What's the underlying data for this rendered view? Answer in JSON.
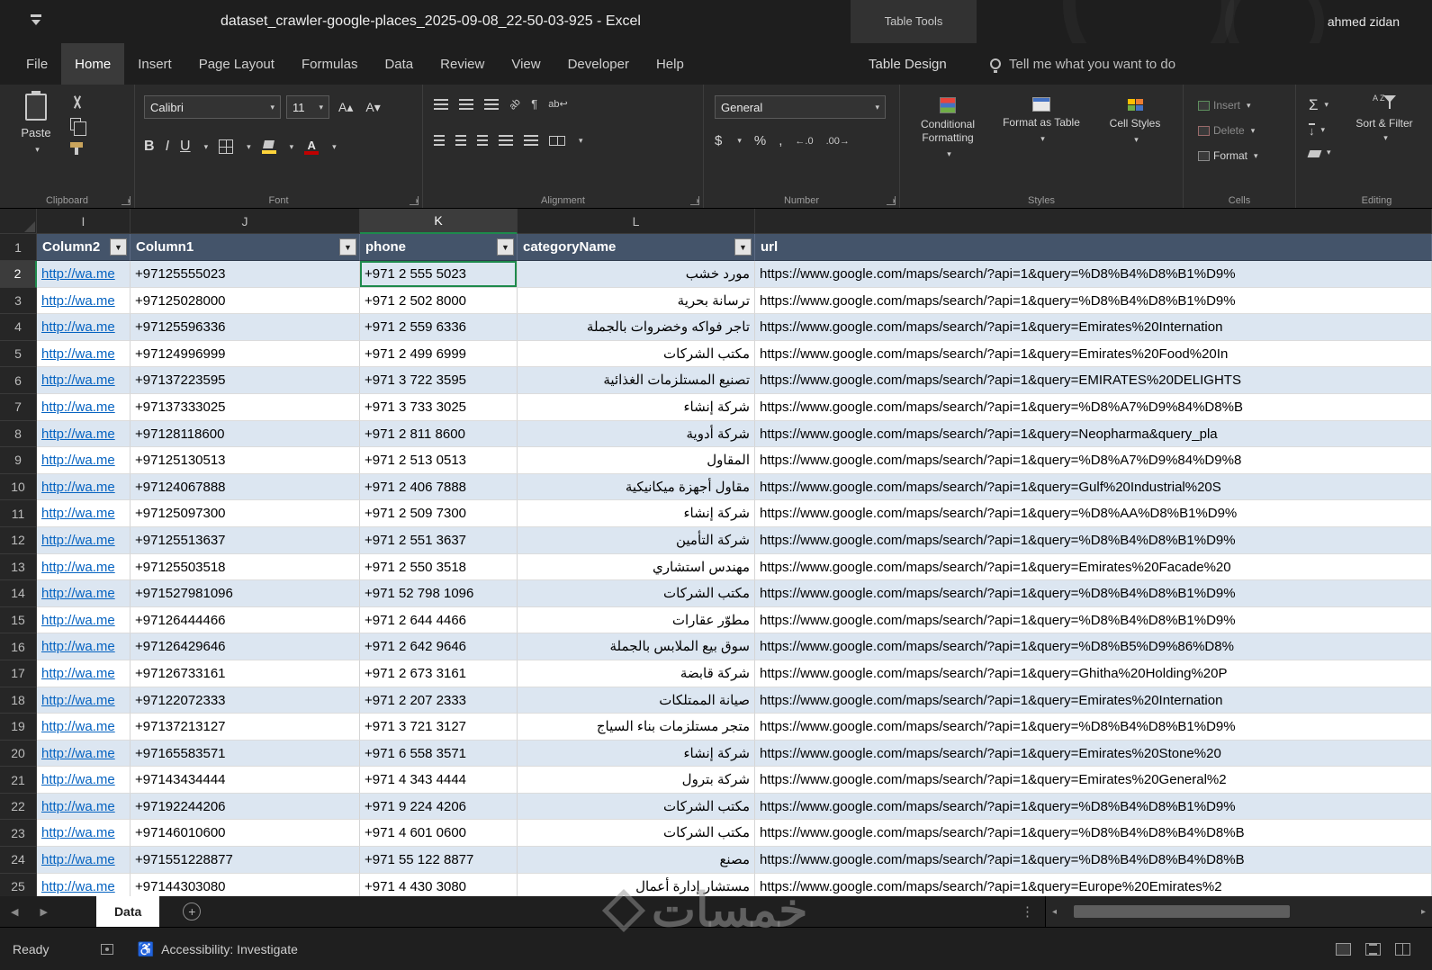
{
  "title_bar": {
    "title": "dataset_crawler-google-places_2025-09-08_22-50-03-925  -  Excel",
    "table_tools": "Table Tools",
    "user": "ahmed zidan"
  },
  "tabs": {
    "items": [
      "File",
      "Home",
      "Insert",
      "Page Layout",
      "Formulas",
      "Data",
      "Review",
      "View",
      "Developer",
      "Help"
    ],
    "contextual": "Table Design",
    "active": "Home",
    "tell_me": "Tell me what you want to do"
  },
  "ribbon": {
    "clipboard": {
      "paste": "Paste",
      "label": "Clipboard"
    },
    "font": {
      "name": "Calibri",
      "size": "11",
      "label": "Font"
    },
    "alignment": {
      "label": "Alignment"
    },
    "number": {
      "format": "General",
      "label": "Number"
    },
    "styles": {
      "conditional_formatting": "Conditional Formatting",
      "format_as_table": "Format as Table",
      "cell_styles": "Cell Styles",
      "label": "Styles"
    },
    "cells": {
      "insert": "Insert",
      "delete": "Delete",
      "format": "Format",
      "label": "Cells"
    },
    "editing": {
      "sort_filter": "Sort & Filter",
      "label": "Editing"
    }
  },
  "icons": {
    "dropdown": "▾",
    "filter": "▼",
    "bold": "B",
    "italic": "I",
    "underline": "U",
    "grow_font": "A▴",
    "shrink_font": "A▾",
    "font_color_letter": "A",
    "orientation": "ab",
    "wrap_text": "ab↩",
    "paragraph": "¶",
    "dollar": "$",
    "percent": "%",
    "comma": ",",
    "increase_decimal": "←.0",
    "decrease_decimal": ".00→",
    "sigma": "Σ",
    "fill_down": "↓",
    "sort_az": "A Z",
    "plus": "+",
    "kebab": "⋮",
    "tab_left": "◀",
    "tab_right": "▶",
    "scroll_left": "◂",
    "scroll_right": "▸",
    "accessibility": "♿"
  },
  "grid": {
    "column_letters": [
      "I",
      "J",
      "K",
      "L"
    ],
    "headers": [
      "Column2",
      "Column1",
      "phone",
      "categoryName",
      "url"
    ],
    "rows": [
      {
        "n": "2",
        "whatsapp": "http://wa.me",
        "column1": "+97125555023",
        "phone": "+971 2 555 5023",
        "category": "مورد خشب",
        "url": "https://www.google.com/maps/search/?api=1&query=%D8%B4%D8%B1%D9%"
      },
      {
        "n": "3",
        "whatsapp": "http://wa.me",
        "column1": "+97125028000",
        "phone": "+971 2 502 8000",
        "category": "ترسانة بحرية",
        "url": "https://www.google.com/maps/search/?api=1&query=%D8%B4%D8%B1%D9%"
      },
      {
        "n": "4",
        "whatsapp": "http://wa.me",
        "column1": "+97125596336",
        "phone": "+971 2 559 6336",
        "category": "تاجر فواكه وخضروات بالجملة",
        "url": "https://www.google.com/maps/search/?api=1&query=Emirates%20Internation"
      },
      {
        "n": "5",
        "whatsapp": "http://wa.me",
        "column1": "+97124996999",
        "phone": "+971 2 499 6999",
        "category": "مكتب الشركات",
        "url": "https://www.google.com/maps/search/?api=1&query=Emirates%20Food%20In"
      },
      {
        "n": "6",
        "whatsapp": "http://wa.me",
        "column1": "+97137223595",
        "phone": "+971 3 722 3595",
        "category": "تصنيع المستلزمات الغذائية",
        "url": "https://www.google.com/maps/search/?api=1&query=EMIRATES%20DELIGHTS"
      },
      {
        "n": "7",
        "whatsapp": "http://wa.me",
        "column1": "+97137333025",
        "phone": "+971 3 733 3025",
        "category": "شركة إنشاء",
        "url": "https://www.google.com/maps/search/?api=1&query=%D8%A7%D9%84%D8%B"
      },
      {
        "n": "8",
        "whatsapp": "http://wa.me",
        "column1": "+97128118600",
        "phone": "+971 2 811 8600",
        "category": "شركة أدوية",
        "url": "https://www.google.com/maps/search/?api=1&query=Neopharma&query_pla"
      },
      {
        "n": "9",
        "whatsapp": "http://wa.me",
        "column1": "+97125130513",
        "phone": "+971 2 513 0513",
        "category": "المقاول",
        "url": "https://www.google.com/maps/search/?api=1&query=%D8%A7%D9%84%D9%8"
      },
      {
        "n": "10",
        "whatsapp": "http://wa.me",
        "column1": "+97124067888",
        "phone": "+971 2 406 7888",
        "category": "مقاول أجهزة ميكانيكية",
        "url": "https://www.google.com/maps/search/?api=1&query=Gulf%20Industrial%20S"
      },
      {
        "n": "11",
        "whatsapp": "http://wa.me",
        "column1": "+97125097300",
        "phone": "+971 2 509 7300",
        "category": "شركة إنشاء",
        "url": "https://www.google.com/maps/search/?api=1&query=%D8%AA%D8%B1%D9%"
      },
      {
        "n": "12",
        "whatsapp": "http://wa.me",
        "column1": "+97125513637",
        "phone": "+971 2 551 3637",
        "category": "شركة التأمين",
        "url": "https://www.google.com/maps/search/?api=1&query=%D8%B4%D8%B1%D9%"
      },
      {
        "n": "13",
        "whatsapp": "http://wa.me",
        "column1": "+97125503518",
        "phone": "+971 2 550 3518",
        "category": "مهندس استشاري",
        "url": "https://www.google.com/maps/search/?api=1&query=Emirates%20Facade%20"
      },
      {
        "n": "14",
        "whatsapp": "http://wa.me",
        "column1": "+971527981096",
        "phone": "+971 52 798 1096",
        "category": "مكتب الشركات",
        "url": "https://www.google.com/maps/search/?api=1&query=%D8%B4%D8%B1%D9%"
      },
      {
        "n": "15",
        "whatsapp": "http://wa.me",
        "column1": "+97126444466",
        "phone": "+971 2 644 4466",
        "category": "مطوّر عقارات",
        "url": "https://www.google.com/maps/search/?api=1&query=%D8%B4%D8%B1%D9%"
      },
      {
        "n": "16",
        "whatsapp": "http://wa.me",
        "column1": "+97126429646",
        "phone": "+971 2 642 9646",
        "category": "سوق بيع الملابس بالجملة",
        "url": "https://www.google.com/maps/search/?api=1&query=%D8%B5%D9%86%D8%"
      },
      {
        "n": "17",
        "whatsapp": "http://wa.me",
        "column1": "+97126733161",
        "phone": "+971 2 673 3161",
        "category": "شركة قابضة",
        "url": "https://www.google.com/maps/search/?api=1&query=Ghitha%20Holding%20P"
      },
      {
        "n": "18",
        "whatsapp": "http://wa.me",
        "column1": "+97122072333",
        "phone": "+971 2 207 2333",
        "category": "صيانة الممتلكات",
        "url": "https://www.google.com/maps/search/?api=1&query=Emirates%20Internation"
      },
      {
        "n": "19",
        "whatsapp": "http://wa.me",
        "column1": "+97137213127",
        "phone": "+971 3 721 3127",
        "category": "متجر مستلزمات بناء السياج",
        "url": "https://www.google.com/maps/search/?api=1&query=%D8%B4%D8%B1%D9%"
      },
      {
        "n": "20",
        "whatsapp": "http://wa.me",
        "column1": "+97165583571",
        "phone": "+971 6 558 3571",
        "category": "شركة إنشاء",
        "url": "https://www.google.com/maps/search/?api=1&query=Emirates%20Stone%20"
      },
      {
        "n": "21",
        "whatsapp": "http://wa.me",
        "column1": "+97143434444",
        "phone": "+971 4 343 4444",
        "category": "شركة بترول",
        "url": "https://www.google.com/maps/search/?api=1&query=Emirates%20General%2"
      },
      {
        "n": "22",
        "whatsapp": "http://wa.me",
        "column1": "+97192244206",
        "phone": "+971 9 224 4206",
        "category": "مكتب الشركات",
        "url": "https://www.google.com/maps/search/?api=1&query=%D8%B4%D8%B1%D9%"
      },
      {
        "n": "23",
        "whatsapp": "http://wa.me",
        "column1": "+97146010600",
        "phone": "+971 4 601 0600",
        "category": "مكتب الشركات",
        "url": "https://www.google.com/maps/search/?api=1&query=%D8%B4%D8%B4%D8%B"
      },
      {
        "n": "24",
        "whatsapp": "http://wa.me",
        "column1": "+971551228877",
        "phone": "+971 55 122 8877",
        "category": "مصنع",
        "url": "https://www.google.com/maps/search/?api=1&query=%D8%B4%D8%B4%D8%B"
      },
      {
        "n": "25",
        "whatsapp": "http://wa.me",
        "column1": "+97144303080",
        "phone": "+971 4 430 3080",
        "category": "مستشار إدارة أعمال",
        "url": "https://www.google.com/maps/search/?api=1&query=Europe%20Emirates%2"
      }
    ]
  },
  "sheet_bar": {
    "tab": "Data"
  },
  "status_bar": {
    "ready": "Ready",
    "accessibility": "Accessibility: Investigate"
  },
  "watermark": "خمسات",
  "colors": {
    "accent_green": "#1E8A4C",
    "table_header_bg": "#44546A",
    "band_blue": "#DCE6F1",
    "link_blue": "#0563C1",
    "fill_yellow": "#FFD43B",
    "font_color_red": "#C00000"
  }
}
